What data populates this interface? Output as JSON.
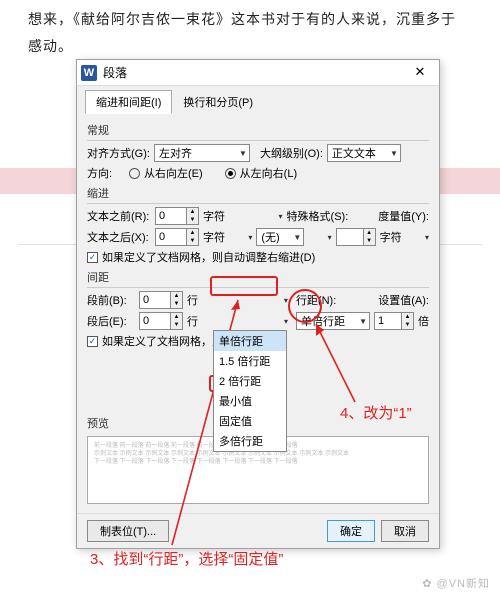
{
  "bg": {
    "line1": "想来，《献给阿尔吉侬一束花》这本书对于有的人来说，沉重多于",
    "line2": "感动。"
  },
  "dialog": {
    "title": "段落",
    "tabs": {
      "indent": "缩进和间距(I)",
      "page": "换行和分页(P)"
    },
    "general": {
      "label": "常规",
      "align_l": "对齐方式(G):",
      "align_v": "左对齐",
      "outline_l": "大纲级别(O):",
      "outline_v": "正文文本",
      "dir_l": "方向:",
      "rtl": "从右向左(E)",
      "ltr": "从左向右(L)"
    },
    "indent": {
      "label": "缩进",
      "before_l": "文本之前(R):",
      "before_v": "0",
      "unit_char": "字符",
      "special_l": "特殊格式(S):",
      "measure_l": "度量值(Y):",
      "after_l": "文本之后(X):",
      "after_v": "0",
      "special_v": "(无)",
      "grid_chk": "如果定义了文档网格，则自动调整右缩进(D)"
    },
    "spacing": {
      "label": "间距",
      "before_l": "段前(B):",
      "before_v": "0",
      "unit_line": "行",
      "linesp_l": "行距(N):",
      "setval_l": "设置值(A):",
      "after_l": "段后(E):",
      "after_v": "0",
      "linesp_v": "单倍行距",
      "setval_v": "1",
      "unit_mult": "倍",
      "grid_chk": "如果定义了文档网格，则与网格",
      "options": [
        "单倍行距",
        "1.5 倍行距",
        "2 倍行距",
        "最小值",
        "固定值",
        "多倍行距"
      ]
    },
    "preview_l": "预览",
    "buttons": {
      "tabs": "制表位(T)...",
      "ok": "确定",
      "cancel": "取消"
    }
  },
  "annot": {
    "step3": "3、找到“行距”，选择“固定值”",
    "step4": "4、改为“1”"
  },
  "watermark": "✿ @VN新知"
}
